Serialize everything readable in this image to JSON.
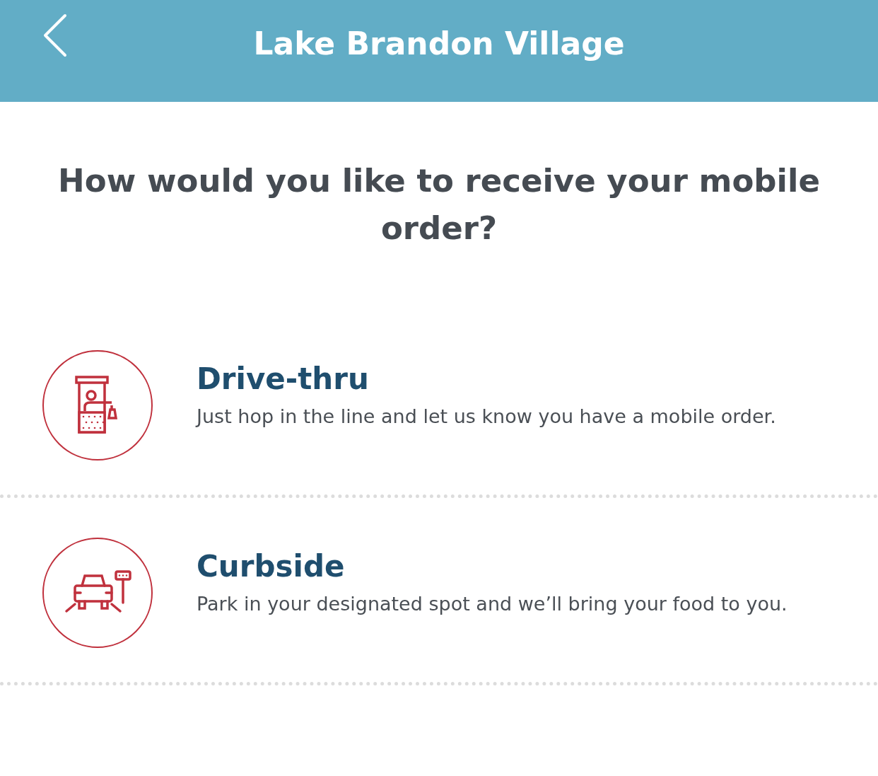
{
  "header": {
    "title": "Lake Brandon Village"
  },
  "question": "How would you like to receive your mobile order?",
  "options": [
    {
      "kind": "drive_thru",
      "title": "Drive-thru",
      "description": "Just hop in the line and let us know you have a mobile order."
    },
    {
      "kind": "curbside",
      "title": "Curbside",
      "description": "Park in your designated spot and we’ll bring your food to you."
    }
  ]
}
